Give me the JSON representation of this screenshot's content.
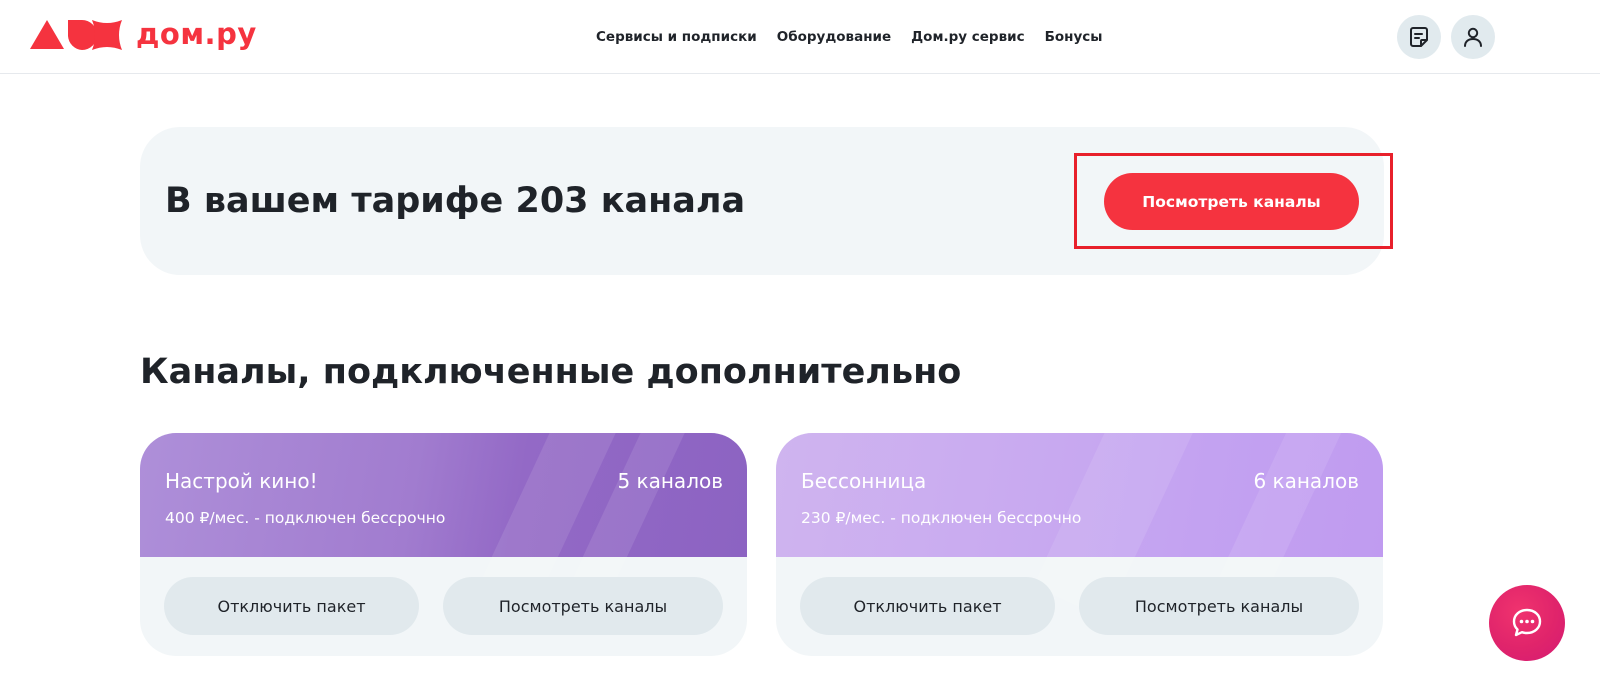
{
  "brand": {
    "name": "дом.ру",
    "color": "#f5333f"
  },
  "nav": {
    "items": [
      "Сервисы и подписки",
      "Оборудование",
      "Дом.ру сервис",
      "Бонусы"
    ]
  },
  "header_actions": {
    "docs_icon": "document-icon",
    "profile_icon": "user-icon"
  },
  "tariff": {
    "title": "В вашем тарифе 203 канала",
    "button_label": "Посмотреть каналы"
  },
  "additional": {
    "title": "Каналы, подключенные дополнительно",
    "packages": [
      {
        "name": "Настрой кино!",
        "count": "5 каналов",
        "price": "400 ₽/мес. - подключен бессрочно",
        "disable_label": "Отключить пакет",
        "view_label": "Посмотреть каналы"
      },
      {
        "name": "Бессонница",
        "count": "6 каналов",
        "price": "230 ₽/мес. - подключен бессрочно",
        "disable_label": "Отключить пакет",
        "view_label": "Посмотреть каналы"
      }
    ]
  },
  "chat": {
    "icon": "chat-bubble-icon",
    "color": "#e0246b"
  }
}
